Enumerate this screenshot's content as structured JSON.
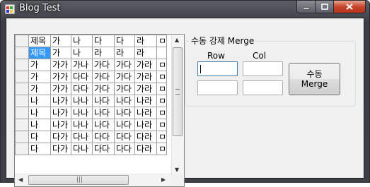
{
  "window": {
    "title": "Blog Test"
  },
  "grid": {
    "header": [
      "제목",
      "가",
      "나",
      "다",
      "다",
      "라",
      "ㅁ"
    ],
    "rows": [
      [
        "제목",
        "가",
        "나",
        "라",
        "라",
        "라",
        ""
      ],
      [
        "가",
        "가가",
        "가나",
        "가다",
        "가다",
        "가라",
        "ㅁ"
      ],
      [
        "가",
        "가가",
        "다다",
        "가다",
        "가다",
        "가라",
        "ㅁ"
      ],
      [
        "가",
        "가가",
        "다다",
        "가다",
        "가다",
        "가라",
        "ㅁ"
      ],
      [
        "나",
        "나가",
        "나나",
        "나다",
        "나다",
        "나라",
        "ㅁ"
      ],
      [
        "나",
        "나가",
        "나나",
        "나다",
        "나다",
        "나라",
        "ㅁ"
      ],
      [
        "나",
        "나가",
        "나나",
        "나다",
        "나다",
        "나라",
        "ㅁ"
      ],
      [
        "다",
        "다가",
        "다나",
        "다다",
        "다다",
        "다라",
        "ㅁ"
      ],
      [
        "다",
        "다가",
        "다나",
        "다다",
        "다다",
        "다라",
        "ㅁ"
      ]
    ]
  },
  "merge_group": {
    "title": "수동 강제 Merge",
    "row_label": "Row",
    "col_label": "Col",
    "row_value": "",
    "col_value": "",
    "row_value2": "",
    "col_value2": "",
    "button_line1": "수동",
    "button_line2": "Merge"
  },
  "colors": {
    "selection": "#3399ff",
    "close_button": "#c8452c"
  }
}
